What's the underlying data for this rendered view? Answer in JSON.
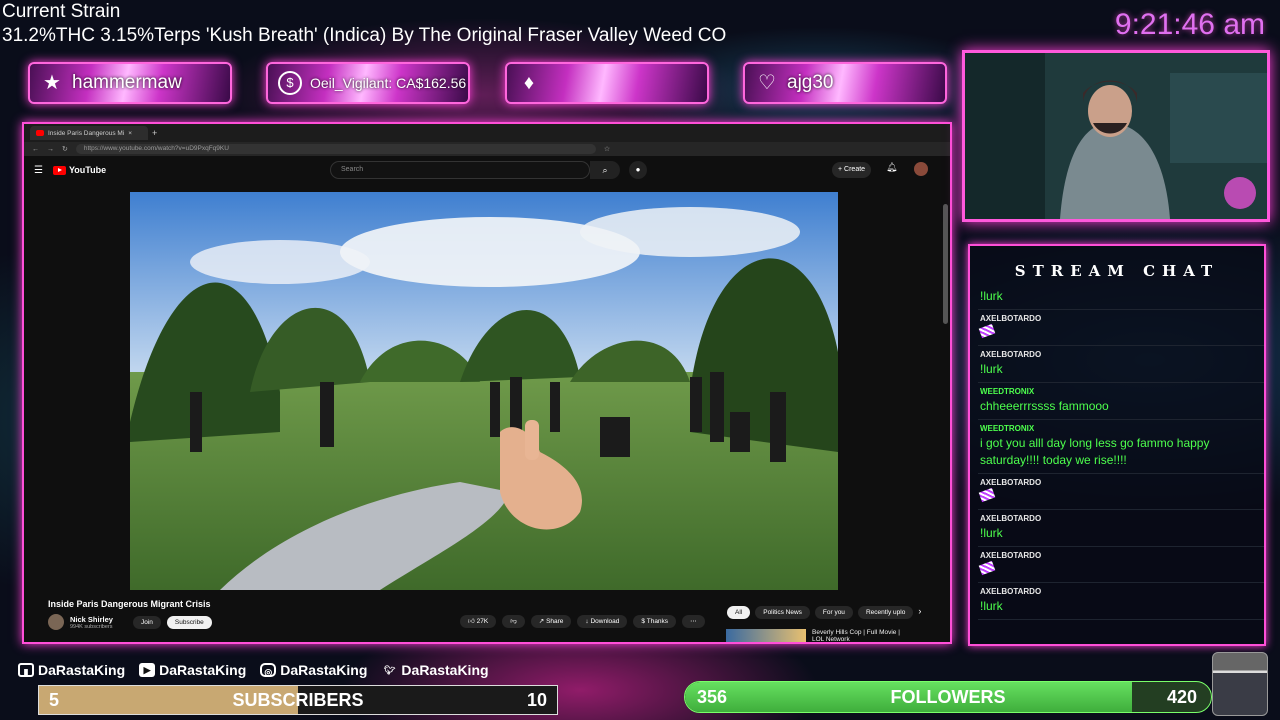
{
  "header": {
    "strain_title": "Current Strain",
    "strain_desc": "31.2%THC 3.15%Terps 'Kush Breath' (Indica) By The Original Fraser Valley Weed CO",
    "clock": "9:21:46 am"
  },
  "alerts": [
    {
      "icon": "star-icon",
      "text": "hammermaw"
    },
    {
      "icon": "dollar-icon",
      "text": "Oeil_Vigilant: CA$162.56"
    },
    {
      "icon": "diamond-icon",
      "text": ""
    },
    {
      "icon": "heart-icon",
      "text": "ajg30"
    }
  ],
  "browser": {
    "tab_title": "Inside Paris Dangerous Mi",
    "url": "https://www.youtube.com/watch?v=uD9PxqFq9KU",
    "logo": "YouTube",
    "search_placeholder": "Search",
    "create_label": "Create",
    "video_title": "Inside Paris Dangerous Migrant Crisis",
    "channel_name": "Nick Shirley",
    "channel_subs": "994K subscribers",
    "join_label": "Join",
    "subscribe_label": "Subscribe",
    "like_count": "27K",
    "share_label": "Share",
    "download_label": "Download",
    "thanks_label": "Thanks",
    "filters": [
      "All",
      "Politics News",
      "For you",
      "Recently uplo"
    ],
    "rec_title": "Beverly Hills Cop | Full Movie | LOL Network"
  },
  "chat": {
    "title": "STREAM CHAT",
    "messages": [
      {
        "user": "",
        "text": "!lurk",
        "emote": false
      },
      {
        "user": "AXELBOTARDO",
        "text": "",
        "emote": true
      },
      {
        "user": "AXELBOTARDO",
        "text": "!lurk",
        "emote": false
      },
      {
        "user": "WEEDTRONIX",
        "text": "chheeerrrssss fammooo",
        "emote": false
      },
      {
        "user": "WEEDTRONIX",
        "text": "i got you alll day long less go fammo happy saturday!!!! today we rise!!!!",
        "emote": false
      },
      {
        "user": "AXELBOTARDO",
        "text": "",
        "emote": true
      },
      {
        "user": "AXELBOTARDO",
        "text": "!lurk",
        "emote": false
      },
      {
        "user": "AXELBOTARDO",
        "text": "",
        "emote": true
      },
      {
        "user": "AXELBOTARDO",
        "text": "!lurk",
        "emote": false
      }
    ]
  },
  "socials": {
    "twitch": "DaRastaKing",
    "youtube": "DaRastaKing",
    "instagram": "DaRastaKing",
    "twitter": "DaRastaKing"
  },
  "subscribers": {
    "current": "5",
    "label": "SUBSCRIBERS",
    "goal": "10",
    "progress": 0.5
  },
  "followers": {
    "current": "356",
    "label": "FOLLOWERS",
    "goal": "420",
    "progress": 0.85
  },
  "colors": {
    "accent_pink": "#ff4fd8",
    "chat_green": "#4dff4d",
    "sub_bar": "#c8a872",
    "follower_bar": "#4fc84a"
  }
}
